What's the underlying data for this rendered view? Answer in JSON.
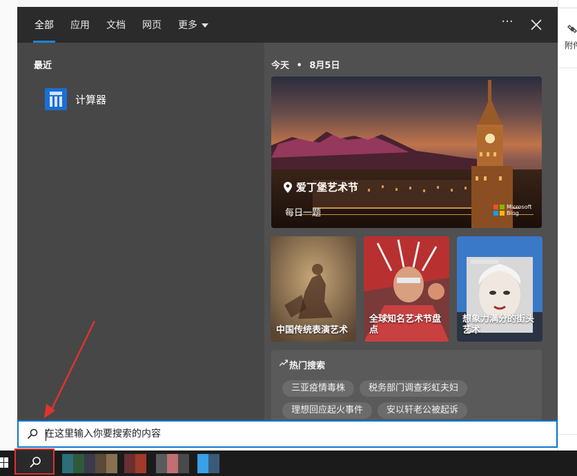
{
  "background_app": {
    "attach_label": "附件"
  },
  "tabs": [
    {
      "label": "全部",
      "active": true
    },
    {
      "label": "应用"
    },
    {
      "label": "文档"
    },
    {
      "label": "网页"
    },
    {
      "label": "更多"
    }
  ],
  "header": {
    "more_options_glyph": "···"
  },
  "recent": {
    "title": "最近",
    "items": [
      {
        "label": "计算器",
        "icon": "calculator-icon"
      }
    ]
  },
  "today": {
    "label": "今天",
    "separator": "•",
    "date": "8月5日"
  },
  "hero": {
    "title": "爱丁堡艺术节",
    "subtitle": "每日一题",
    "brand": "Microsoft Bing"
  },
  "cards": [
    {
      "label": "中国传统表演艺术"
    },
    {
      "label": "全球知名艺术节盘点"
    },
    {
      "label": "想象力满分的街头艺术"
    }
  ],
  "hot_searches": {
    "title": "热门搜索",
    "items": [
      "三亚疫情毒株",
      "税务部门调查彩虹夫妇",
      "理想回应起火事件",
      "安以轩老公被起诉"
    ]
  },
  "search": {
    "placeholder": "在这里输入你要搜索的内容",
    "value": ""
  },
  "colors": {
    "accent": "#1f84d6",
    "panel": "#474747",
    "highlight": "#e0332f"
  }
}
